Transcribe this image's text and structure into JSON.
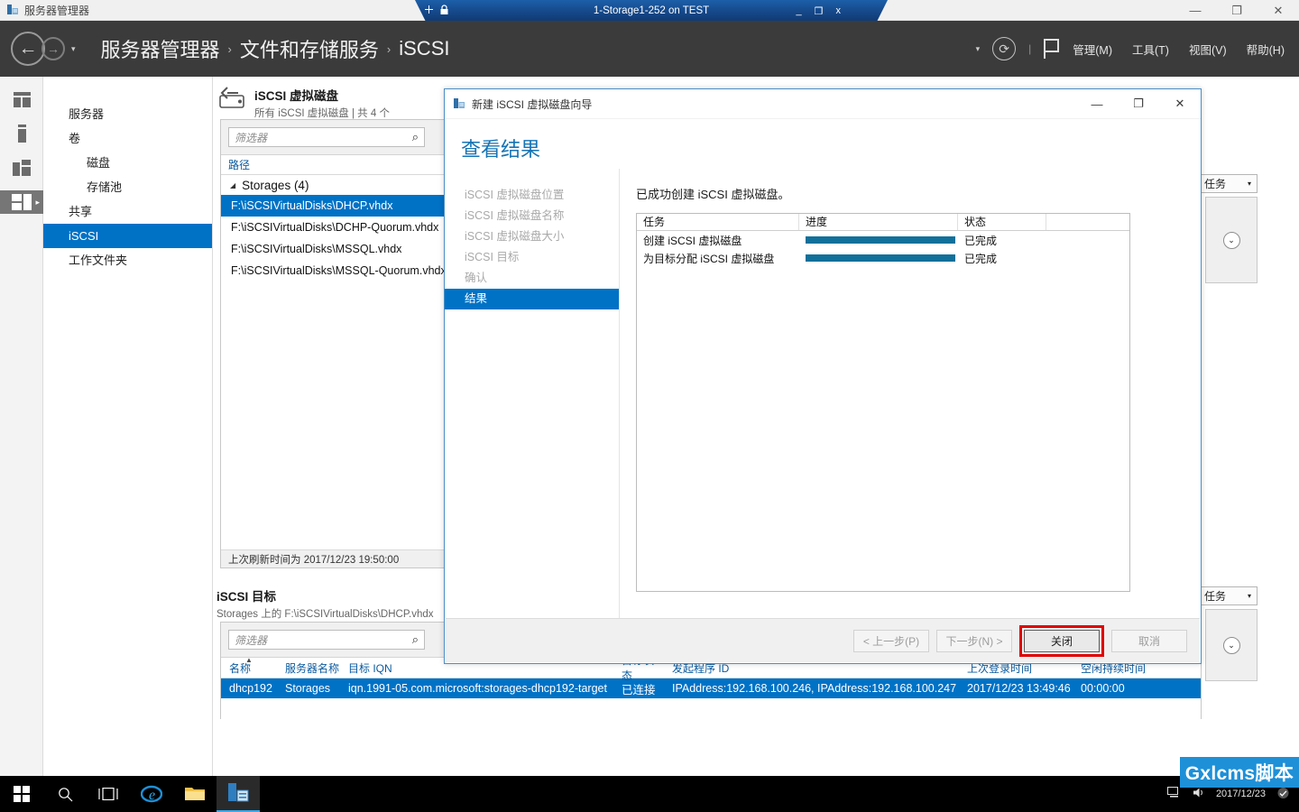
{
  "app_window": {
    "title": "服务器管理器",
    "icon": "server-manager-icon",
    "minimize": "—",
    "maximize": "❐",
    "close": "✕"
  },
  "vm_bar": {
    "title": "1-Storage1-252 on TEST",
    "pin_icon": "pin-icon",
    "lock_icon": "lock-icon",
    "minimize": "_",
    "restore": "❐",
    "close": "x"
  },
  "header": {
    "back_icon": "back-arrow-icon",
    "forward_icon": "forward-arrow-icon",
    "dropdown_caret": "▾",
    "breadcrumb": [
      "服务器管理器",
      "文件和存储服务",
      "iSCSI"
    ],
    "breadcrumb_sep": "›",
    "notify_caret": "▾",
    "refresh_icon": "refresh-icon",
    "flag_icon": "flag-notification-icon",
    "menus": [
      "管理(M)",
      "工具(T)",
      "视图(V)",
      "帮助(H)"
    ]
  },
  "rail": {
    "items": [
      {
        "icon": "dashboard-icon"
      },
      {
        "icon": "local-server-icon"
      },
      {
        "icon": "all-servers-icon"
      },
      {
        "icon": "file-storage-services-icon",
        "active": true,
        "arrow": "▸"
      }
    ]
  },
  "sidebar": {
    "items": [
      {
        "label": "服务器",
        "sub": false,
        "selected": false
      },
      {
        "label": "卷",
        "sub": false,
        "selected": false
      },
      {
        "label": "磁盘",
        "sub": true,
        "selected": false
      },
      {
        "label": "存储池",
        "sub": true,
        "selected": false
      },
      {
        "label": "共享",
        "sub": false,
        "selected": false
      },
      {
        "label": "iSCSI",
        "sub": false,
        "selected": true
      },
      {
        "label": "工作文件夹",
        "sub": false,
        "selected": false
      }
    ]
  },
  "vdisks_section": {
    "icon": "iscsi-virtual-disk-icon",
    "title": "iSCSI 虚拟磁盘",
    "subtitle": "所有 iSCSI 虚拟磁盘 | 共 4 个",
    "tasks_button": "任务",
    "tasks_caret": "▾",
    "collapse_icon": "chevron-down-icon",
    "filter_placeholder": "筛选器",
    "search_icon": "search-icon",
    "column_header": "路径",
    "group": {
      "caret": "◢",
      "label": "Storages (4)"
    },
    "rows": [
      {
        "path": "F:\\iSCSIVirtualDisks\\DHCP.vhdx",
        "selected": true
      },
      {
        "path": "F:\\iSCSIVirtualDisks\\DCHP-Quorum.vhdx",
        "selected": false
      },
      {
        "path": "F:\\iSCSIVirtualDisks\\MSSQL.vhdx",
        "selected": false
      },
      {
        "path": "F:\\iSCSIVirtualDisks\\MSSQL-Quorum.vhdx",
        "selected": false
      }
    ],
    "refresh_status": "上次刷新时间为 2017/12/23 19:50:00"
  },
  "targets_section": {
    "title": "iSCSI 目标",
    "subtitle": "Storages 上的 F:\\iSCSIVirtualDisks\\DHCP.vhdx",
    "tasks_button": "任务",
    "tasks_caret": "▾",
    "collapse_icon": "chevron-down-icon",
    "filter_placeholder": "筛选器",
    "search_icon": "search-icon",
    "columns": [
      {
        "label": "名称",
        "sorted": true,
        "sort_arrow": "▲"
      },
      {
        "label": "服务器名称"
      },
      {
        "label": "目标 IQN"
      },
      {
        "label": "目标状态"
      },
      {
        "label": "发起程序 ID"
      },
      {
        "label": "上次登录时间"
      },
      {
        "label": "空闲持续时间"
      }
    ],
    "rows": [
      {
        "selected": true,
        "name": "dhcp192",
        "server": "Storages",
        "iqn": "iqn.1991-05.com.microsoft:storages-dhcp192-target",
        "status": "已连接",
        "initiator": "IPAddress:192.168.100.246, IPAddress:192.168.100.247",
        "last_login": "2017/12/23 13:49:46",
        "idle": "00:00:00"
      }
    ]
  },
  "wizard": {
    "icon": "wizard-icon",
    "titlebar": "新建 iSCSI 虚拟磁盘向导",
    "minimize": "—",
    "maximize": "❐",
    "close": "✕",
    "heading": "查看结果",
    "steps": [
      {
        "label": "iSCSI 虚拟磁盘位置",
        "current": false
      },
      {
        "label": "iSCSI 虚拟磁盘名称",
        "current": false
      },
      {
        "label": "iSCSI 虚拟磁盘大小",
        "current": false
      },
      {
        "label": "iSCSI 目标",
        "current": false
      },
      {
        "label": "确认",
        "current": false
      },
      {
        "label": "结果",
        "current": true
      }
    ],
    "message": "已成功创建 iSCSI 虚拟磁盘。",
    "table": {
      "columns": [
        "任务",
        "进度",
        "状态"
      ],
      "rows": [
        {
          "task": "创建 iSCSI 虚拟磁盘",
          "progress": 100,
          "status": "已完成"
        },
        {
          "task": "为目标分配 iSCSI 虚拟磁盘",
          "progress": 100,
          "status": "已完成"
        }
      ],
      "progress_color": "#10709a"
    },
    "buttons": [
      {
        "label": "< 上一步(P)",
        "disabled": true,
        "highlighted": false,
        "default": false
      },
      {
        "label": "下一步(N) >",
        "disabled": true,
        "highlighted": false,
        "default": false
      },
      {
        "label": "关闭",
        "disabled": false,
        "highlighted": true,
        "default": true
      },
      {
        "label": "取消",
        "disabled": true,
        "highlighted": false,
        "default": false
      }
    ],
    "highlight_color": "#e00000"
  },
  "taskbar": {
    "start_icon": "windows-start-icon",
    "search_icon": "search-icon",
    "taskview_icon": "task-view-icon",
    "apps": [
      {
        "icon": "internet-explorer-icon",
        "pinned": false
      },
      {
        "icon": "file-explorer-icon",
        "pinned": false
      },
      {
        "icon": "server-manager-icon",
        "pinned": true
      }
    ],
    "tray": {
      "network_icon": "network-icon",
      "volume_icon": "volume-icon",
      "date": "2017/12/23",
      "action_center_icon": "action-center-icon"
    }
  },
  "watermark": {
    "text": "Gxlcms脚本",
    "color": "#1e90d8"
  }
}
